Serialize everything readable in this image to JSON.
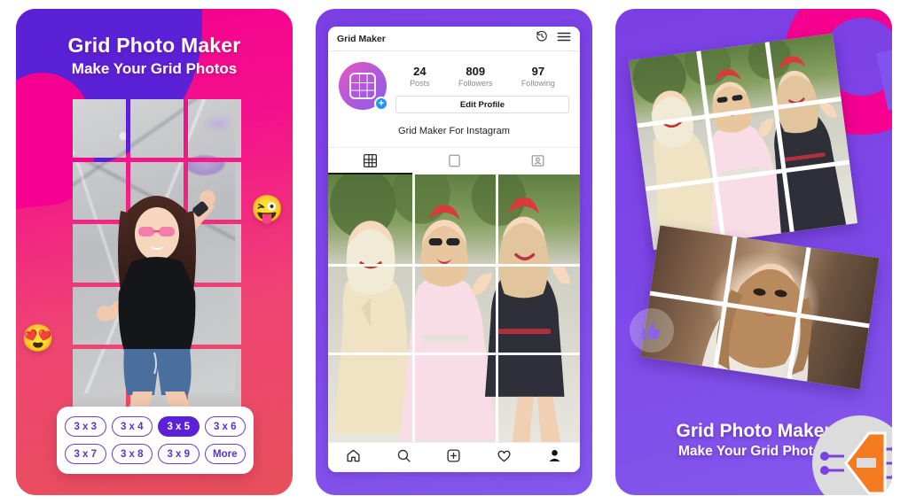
{
  "app": {
    "name": "Grid Photo Maker",
    "tagline": "Make Your Grid Photos"
  },
  "panel1": {
    "title": "Grid Photo Maker",
    "subtitle": "Make Your Grid Photos",
    "grid": {
      "columns": 3,
      "rows": 5
    },
    "emoji_right": "😜",
    "emoji_left": "😍",
    "size_options": [
      {
        "label": "3 x 3",
        "selected": false
      },
      {
        "label": "3 x 4",
        "selected": false
      },
      {
        "label": "3 x 5",
        "selected": true
      },
      {
        "label": "3 x 6",
        "selected": false
      },
      {
        "label": "3 x 7",
        "selected": false
      },
      {
        "label": "3 x 8",
        "selected": false
      },
      {
        "label": "3 x 9",
        "selected": false
      },
      {
        "label": "More",
        "selected": false
      }
    ]
  },
  "panel2": {
    "topbar": {
      "title": "Grid Maker",
      "icons": [
        "history-icon",
        "hamburger-menu-icon"
      ]
    },
    "profile": {
      "avatar_icon": "grid-icon",
      "avatar_badge": "+",
      "stats": [
        {
          "number": "24",
          "label": "Posts"
        },
        {
          "number": "809",
          "label": "Followers"
        },
        {
          "number": "97",
          "label": "Following"
        }
      ],
      "edit_button": "Edit Profile",
      "bio": "Grid Maker For Instagram"
    },
    "tabs": [
      {
        "name": "grid-tab",
        "icon": "grid-icon",
        "active": true
      },
      {
        "name": "reels-tab",
        "icon": "square-icon",
        "active": false
      },
      {
        "name": "tagged-tab",
        "icon": "tagged-person-icon",
        "active": false
      }
    ],
    "bottom_nav": [
      {
        "name": "home-nav",
        "icon": "home-icon",
        "active": false
      },
      {
        "name": "search-nav",
        "icon": "search-icon",
        "active": false
      },
      {
        "name": "add-nav",
        "icon": "plus-box-icon",
        "active": false
      },
      {
        "name": "activity-nav",
        "icon": "heart-icon",
        "active": false
      },
      {
        "name": "profile-nav",
        "icon": "person-icon",
        "active": true
      }
    ]
  },
  "panel3": {
    "title": "Grid Photo Maker",
    "subtitle": "Make Your Grid Photos",
    "collage1": {
      "columns": 3,
      "rows": 3
    },
    "collage2": {
      "columns": 3,
      "rows": 2
    },
    "badge_icon": "thumbs-up-icon",
    "watermark_icon": "orange-chip-logo"
  },
  "colors": {
    "pink": "#F50090",
    "coral": "#E8505B",
    "purple": "#7B3FE4",
    "deep_purple": "#5B21D6",
    "accent_blue": "#2196F3",
    "watermark_orange": "#F47B20",
    "watermark_circle": "#DCDCDC"
  }
}
